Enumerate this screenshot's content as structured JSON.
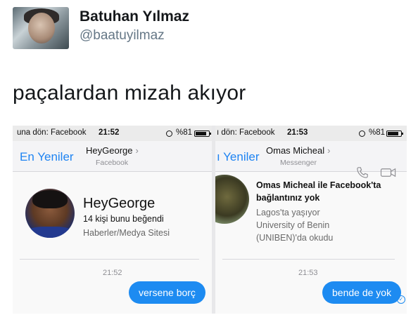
{
  "tweet": {
    "display_name": "Batuhan Yılmaz",
    "handle": "@baatuyilmaz",
    "text": "paçalardan mizah akıyor"
  },
  "left_screen": {
    "status_back": "una dön: Facebook",
    "status_time": "21:52",
    "status_battery": "%81",
    "nav_back": "En Yeniler",
    "nav_title": "HeyGeorge",
    "nav_subtitle": "Facebook",
    "profile_name": "HeyGeorge",
    "profile_likes": "14 kişi bunu beğendi",
    "profile_category": "Haberler/Medya Sitesi",
    "chat_time": "21:52",
    "message": "versene borç"
  },
  "right_screen": {
    "status_back": "ı dön: Facebook",
    "status_time": "21:53",
    "status_battery": "%81",
    "nav_back": "ı Yeniler",
    "nav_title": "Omas Micheal",
    "nav_subtitle": "Messenger",
    "info_line1": "Omas Micheal ile Facebook'ta",
    "info_line2": "bağlantınız yok",
    "detail_line1": "Lagos'ta yaşıyor",
    "detail_line2": "University of Benin",
    "detail_line3": "(UNIBEN)'da okudu",
    "chat_time": "21:53",
    "message": "bende de yok"
  },
  "colors": {
    "accent": "#1d8bf1",
    "nav_link": "#1f84f2",
    "handle_gray": "#657786"
  },
  "icons": [
    "profile-avatar",
    "chevron-right-icon",
    "alarm-icon",
    "battery-icon",
    "phone-icon",
    "video-camera-icon",
    "seen-check-icon"
  ]
}
